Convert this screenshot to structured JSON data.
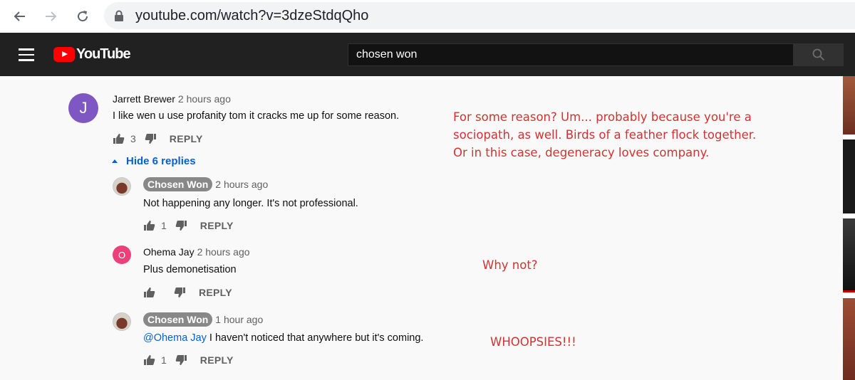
{
  "browser": {
    "url": "youtube.com/watch?v=3dzeStdqQho"
  },
  "header": {
    "logo_text": "YouTube",
    "search_value": "chosen won"
  },
  "comments": {
    "main": {
      "avatar_letter": "J",
      "avatar_color": "#7e57c2",
      "author": "Jarrett Brewer",
      "time": "2 hours ago",
      "text": "I like wen u use profanity tom it cracks me up for some reason.",
      "likes": "3",
      "reply_label": "REPLY"
    },
    "hide_replies_label": "Hide 6 replies",
    "replies": [
      {
        "author": "Chosen Won",
        "time": "2 hours ago",
        "text": "Not happening any longer. It's not professional.",
        "likes": "1",
        "reply_label": "REPLY"
      },
      {
        "avatar_letter": "O",
        "avatar_color": "#ec407a",
        "author": "Ohema Jay",
        "time": "2 hours ago",
        "text": "Plus demonetisation",
        "likes": "",
        "reply_label": "REPLY"
      },
      {
        "author": "Chosen Won",
        "time": "1 hour ago",
        "mention": "@Ohema Jay",
        "text": " I haven't noticed that anywhere but it's coming.",
        "likes": "1",
        "reply_label": "REPLY"
      }
    ]
  },
  "annotations": {
    "note1": "For some reason? Um... probably because you're a sociopath, as well. Birds of a feather flock together. Or in this case, degeneracy loves company.",
    "note2": "Why not?",
    "note3": "WHOOPSIES!!!",
    "color": "#d23232"
  }
}
